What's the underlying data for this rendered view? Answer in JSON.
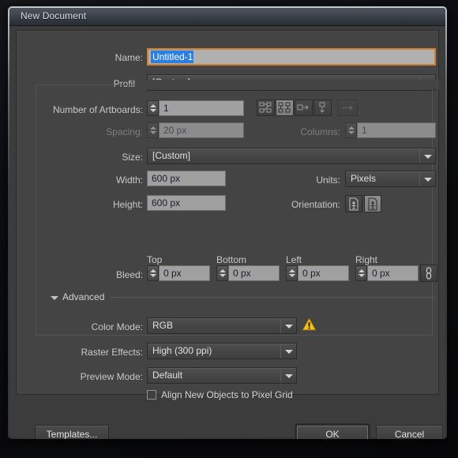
{
  "window": {
    "title": "New Document"
  },
  "fields": {
    "name_label": "Name:",
    "name_value": "Untitled-1",
    "profile_label": "Profile:",
    "profile_value": "[Custom]",
    "artboards_label": "Number of Artboards:",
    "artboards_value": "1",
    "spacing_label": "Spacing:",
    "spacing_value": "20 px",
    "columns_label": "Columns:",
    "columns_value": "1",
    "size_label": "Size:",
    "size_value": "[Custom]",
    "width_label": "Width:",
    "width_value": "600 px",
    "height_label": "Height:",
    "height_value": "600 px",
    "units_label": "Units:",
    "units_value": "Pixels",
    "orientation_label": "Orientation:"
  },
  "bleed": {
    "label": "Bleed:",
    "headers": [
      "Top",
      "Bottom",
      "Left",
      "Right"
    ],
    "values": [
      "0 px",
      "0 px",
      "0 px",
      "0 px"
    ]
  },
  "advanced": {
    "section_label": "Advanced",
    "color_mode_label": "Color Mode:",
    "color_mode_value": "RGB",
    "raster_label": "Raster Effects:",
    "raster_value": "High (300 ppi)",
    "preview_label": "Preview Mode:",
    "preview_value": "Default",
    "align_pixel_grid_label": "Align New Objects to Pixel Grid",
    "align_pixel_grid_checked": false
  },
  "footer": {
    "templates_label": "Templates...",
    "ok_label": "OK",
    "cancel_label": "Cancel"
  },
  "colors": {
    "dialog_bg": "#3c3c3c",
    "panel_bg": "#444444",
    "input_bg": "#a0a0a0",
    "focus_border": "#d08030",
    "selection_blue": "#2a7fe0",
    "warning_yellow": "#f0c020",
    "text": "#c8c8c8"
  }
}
